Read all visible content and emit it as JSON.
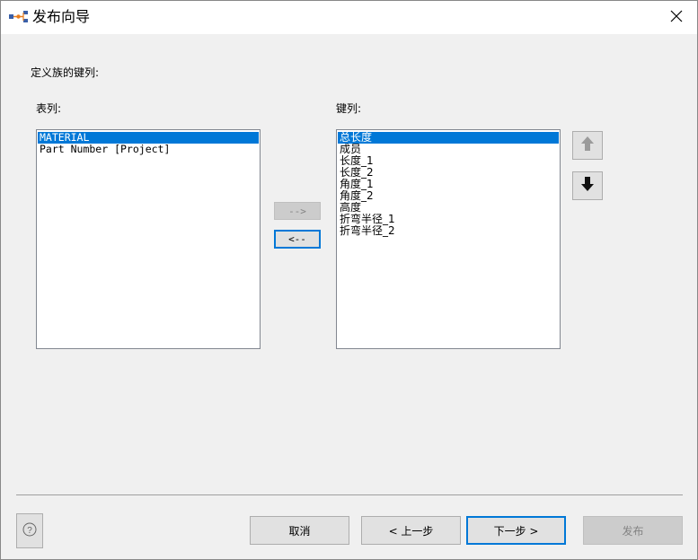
{
  "window": {
    "title": "发布向导",
    "title_icon": "wizard-icon",
    "close_icon": "close-icon"
  },
  "content": {
    "heading": "定义族的键列:",
    "table_label": "表列:",
    "key_label": "键列:",
    "table_columns": [
      {
        "label": "MATERIAL",
        "selected": true
      },
      {
        "label": "Part Number [Project]",
        "selected": false
      }
    ],
    "key_columns": [
      {
        "label": "总长度",
        "selected": true
      },
      {
        "label": "成员",
        "selected": false
      },
      {
        "label": "长度_1",
        "selected": false
      },
      {
        "label": "长度_2",
        "selected": false
      },
      {
        "label": "角度_1",
        "selected": false
      },
      {
        "label": "角度_2",
        "selected": false
      },
      {
        "label": "高度",
        "selected": false
      },
      {
        "label": "折弯半径_1",
        "selected": false
      },
      {
        "label": "折弯半径_2",
        "selected": false
      }
    ],
    "add_button": "-->",
    "remove_button": "<--",
    "move_up_icon": "arrow-up-icon",
    "move_down_icon": "arrow-down-icon"
  },
  "footer": {
    "help_icon": "help-icon",
    "cancel": "取消",
    "back": "< 上一步",
    "next": "下一步 >",
    "publish": "发布"
  },
  "colors": {
    "selection": "#0078d7",
    "dialog_bg": "#f0f0f0",
    "default_button_border": "#0078d7"
  }
}
